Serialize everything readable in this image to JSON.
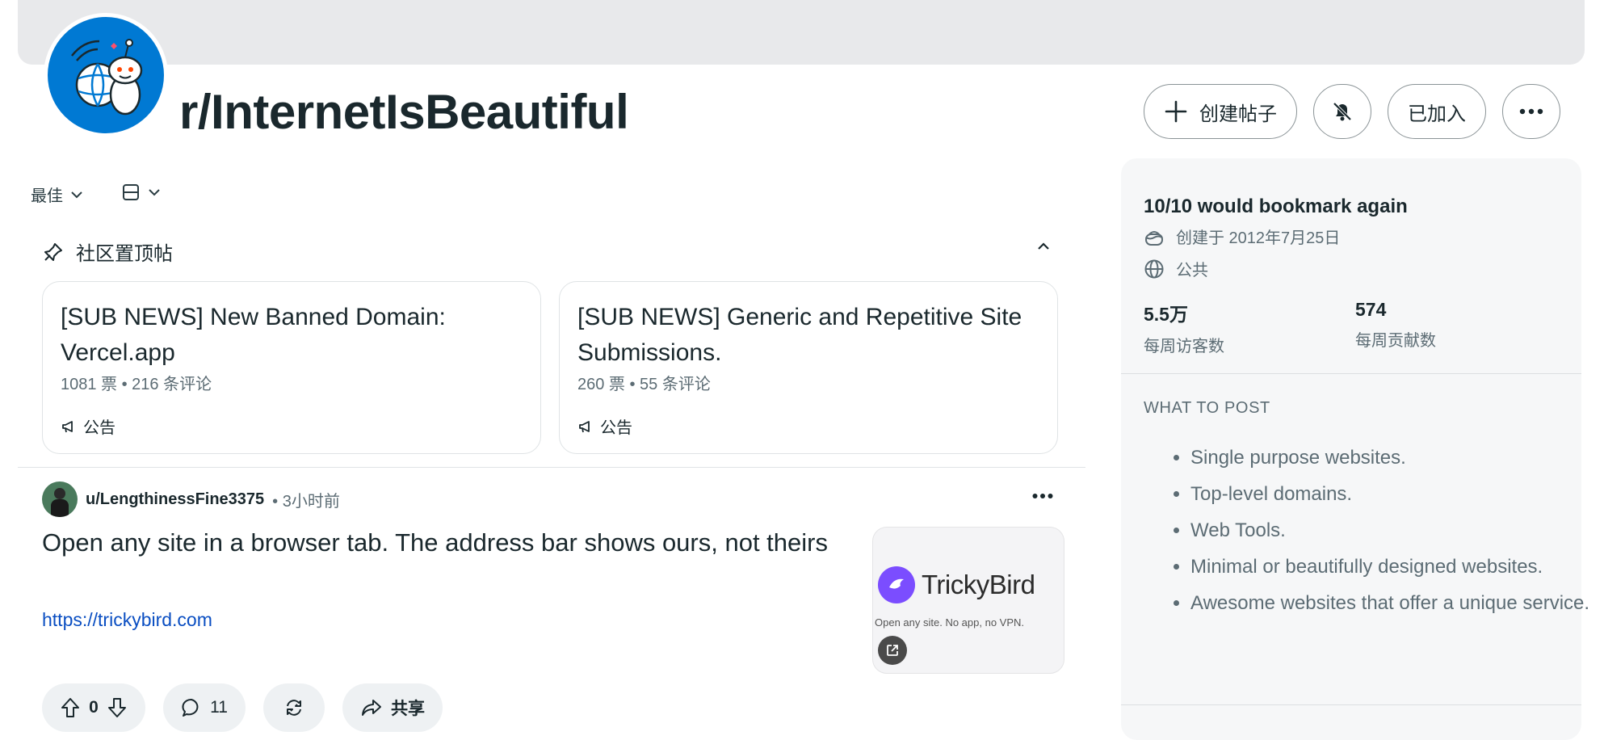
{
  "header": {
    "subreddit_name": "r/InternetIsBeautiful",
    "create_post_label": "创建帖子",
    "joined_label": "已加入",
    "more_icon": "ellipsis-icon",
    "bell_icon": "bell-off-icon"
  },
  "feed_controls": {
    "sort_label": "最佳",
    "view_icon": "card-view-icon"
  },
  "pinned": {
    "header_label": "社区置顶帖",
    "cards": [
      {
        "title": "[SUB NEWS] New Banned Domain: Vercel.app",
        "meta": "1081 票 • 216 条评论",
        "tag": "公告"
      },
      {
        "title": "[SUB NEWS] Generic and Repetitive Site Submissions.",
        "meta": "260 票 • 55 条评论",
        "tag": "公告"
      }
    ]
  },
  "post": {
    "username": "u/LengthinessFine3375",
    "time": "• 3小时前",
    "title": "Open any site in a browser tab. The address bar shows ours, not theirs",
    "link": "https://trickybird.com",
    "thumbnail": {
      "brand": "TrickyBird",
      "tagline": "Open any site. No app, no VPN."
    },
    "vote_count": "0",
    "comment_count": "11",
    "share_label": "共享"
  },
  "sidebar": {
    "title": "10/10 would bookmark again",
    "created": "创建于 2012年7月25日",
    "visibility": "公共",
    "stats": [
      {
        "value": "5.5万",
        "label": "每周访客数"
      },
      {
        "value": "574",
        "label": "每周贡献数"
      }
    ],
    "section_title": "WHAT TO POST",
    "rules": [
      "Single purpose websites.",
      "Top-level domains.",
      "Web Tools.",
      "Minimal or beautifully designed websites.",
      "Awesome websites that offer a unique service."
    ]
  },
  "colors": {
    "accent_blue": "#0079d3",
    "link_blue": "#0a4ec2",
    "thumb_purple": "#7b4dff"
  }
}
